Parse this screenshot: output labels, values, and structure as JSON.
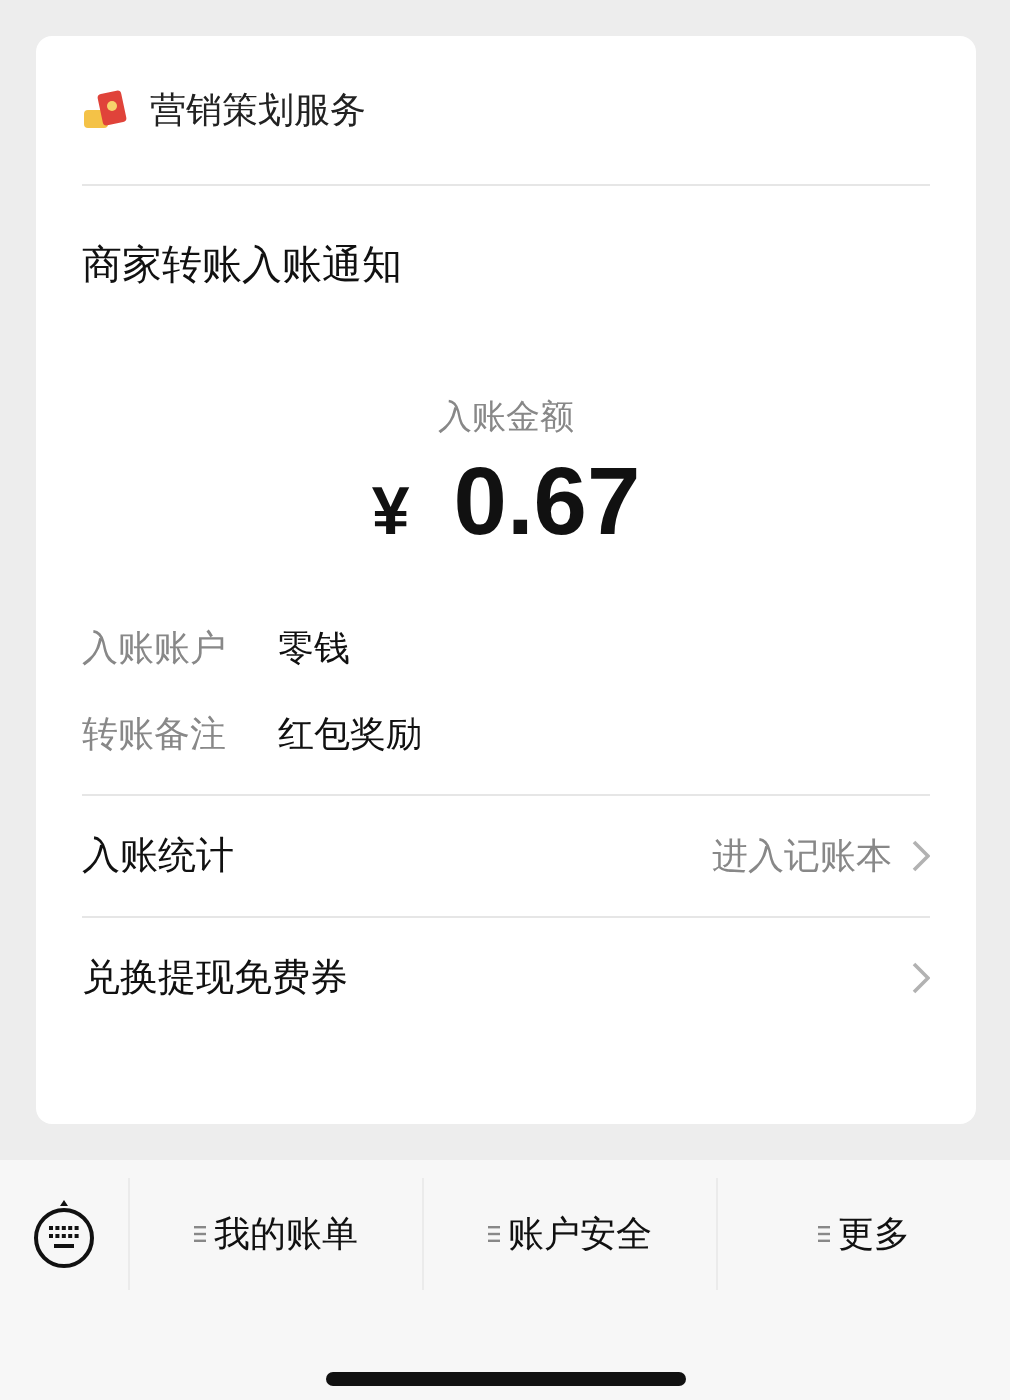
{
  "header": {
    "service_name": "营销策划服务"
  },
  "title": "商家转账入账通知",
  "amount": {
    "label": "入账金额",
    "currency": "¥",
    "value": "0.67"
  },
  "details": [
    {
      "label": "入账账户",
      "value": "零钱"
    },
    {
      "label": "转账备注",
      "value": "红包奖励"
    }
  ],
  "links": [
    {
      "label": "入账统计",
      "hint": "进入记账本"
    },
    {
      "label": "兑换提现免费券"
    }
  ],
  "menu": [
    {
      "label": "我的账单"
    },
    {
      "label": "账户安全"
    },
    {
      "label": "更多"
    }
  ]
}
